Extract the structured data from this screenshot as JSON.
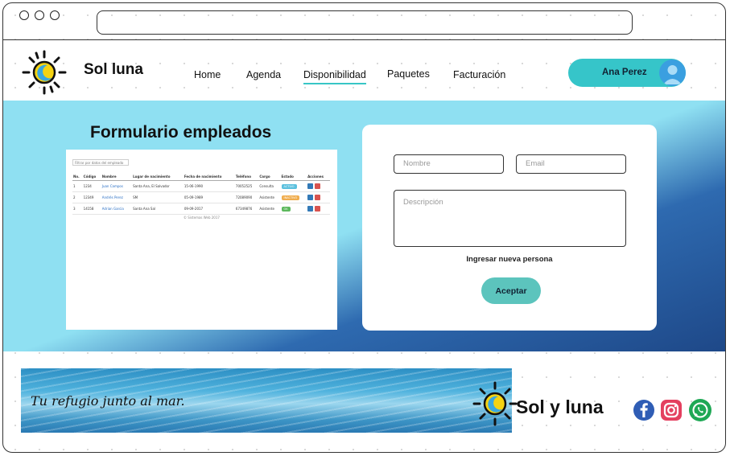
{
  "window": {
    "url_value": ""
  },
  "header": {
    "brand": "Sol luna",
    "nav": [
      "Home",
      "Agenda",
      "Disponibilidad",
      "Paquetes",
      "Facturación"
    ],
    "active_nav": "Disponibilidad",
    "user_name": "Ana Perez"
  },
  "hero": {
    "title": "Formulario empleados",
    "table": {
      "filter_label": "Filtrar por datos del empleado",
      "headers": [
        "No.",
        "Código",
        "Nombre",
        "Lugar de nacimiento",
        "Fecha de nacimiento",
        "Teléfono",
        "Cargo",
        "Estado",
        "Acciones"
      ],
      "rows": [
        [
          "1",
          "1234",
          "Juan Campos",
          "Santa Ana, El Salvador",
          "15-06-1990",
          "70052525",
          "Consulta",
          "ACTIVO"
        ],
        [
          "2",
          "12349",
          "Andrés Perez",
          "SM",
          "05-09-1989",
          "72089090",
          "Asistente",
          "INACTIVO"
        ],
        [
          "3",
          "14158",
          "Adrian Garcia",
          "Santa Ana Sal",
          "09-09-2017",
          "67349876",
          "Asistente",
          "OK"
        ]
      ],
      "footer_text": "© Sistemas Web 2017"
    },
    "form": {
      "name_placeholder": "Nombre",
      "email_placeholder": "Email",
      "description_placeholder": "Descripción",
      "caption": "Ingresar nueva persona",
      "accept_label": "Aceptar"
    }
  },
  "footer": {
    "tagline": "Tu refugio junto al mar.",
    "brand": "Sol y luna",
    "social": [
      "facebook-icon",
      "instagram-icon",
      "whatsapp-icon"
    ]
  },
  "colors": {
    "accent": "#36c5c9",
    "hero_light": "#8fe0f2",
    "hero_dark": "#1e4888",
    "sun_yellow": "#f5d313",
    "moon_blue": "#3aa8e0"
  }
}
